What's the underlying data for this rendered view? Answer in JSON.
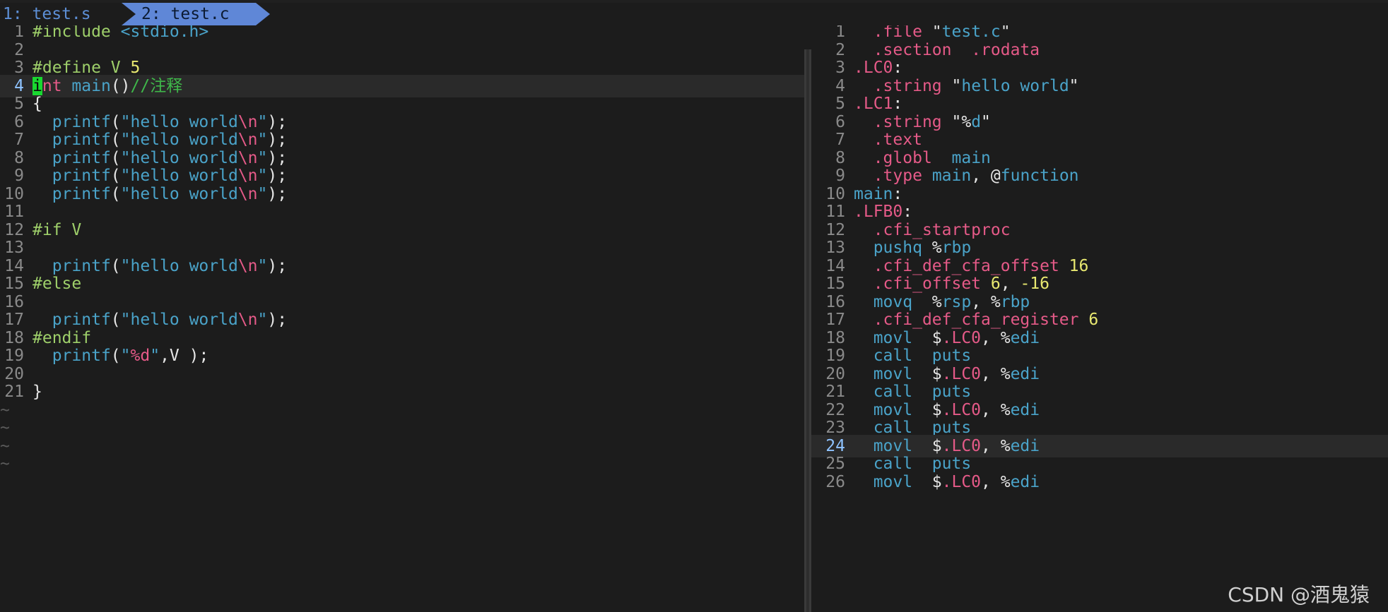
{
  "tabs": [
    {
      "label": "1: test.s",
      "active": false
    },
    {
      "label": "2: test.c",
      "active": true
    }
  ],
  "left_pane": {
    "cursor_line": 4,
    "lines": [
      {
        "n": "1",
        "tokens": [
          [
            "c-pre",
            "#include "
          ],
          [
            "c-str",
            "<stdio.h>"
          ]
        ]
      },
      {
        "n": "2",
        "tokens": []
      },
      {
        "n": "3",
        "tokens": [
          [
            "c-pre",
            "#define V "
          ],
          [
            "c-num",
            "5"
          ]
        ]
      },
      {
        "n": "4",
        "tokens": [
          [
            "cursor",
            "i"
          ],
          [
            "c-kw",
            "nt"
          ],
          [
            "c-txt",
            " "
          ],
          [
            "c-fn",
            "main"
          ],
          [
            "c-txt",
            "()"
          ],
          [
            "c-cmt",
            "//注释"
          ]
        ]
      },
      {
        "n": "5",
        "tokens": [
          [
            "c-txt",
            "{"
          ]
        ]
      },
      {
        "n": "6",
        "tokens": [
          [
            "c-txt",
            "  "
          ],
          [
            "c-fn",
            "printf"
          ],
          [
            "c-txt",
            "("
          ],
          [
            "c-str",
            "\"hello world"
          ],
          [
            "c-esc",
            "\\n"
          ],
          [
            "c-str",
            "\""
          ],
          [
            "c-txt",
            ");"
          ]
        ]
      },
      {
        "n": "7",
        "tokens": [
          [
            "c-txt",
            "  "
          ],
          [
            "c-fn",
            "printf"
          ],
          [
            "c-txt",
            "("
          ],
          [
            "c-str",
            "\"hello world"
          ],
          [
            "c-esc",
            "\\n"
          ],
          [
            "c-str",
            "\""
          ],
          [
            "c-txt",
            ");"
          ]
        ]
      },
      {
        "n": "8",
        "tokens": [
          [
            "c-txt",
            "  "
          ],
          [
            "c-fn",
            "printf"
          ],
          [
            "c-txt",
            "("
          ],
          [
            "c-str",
            "\"hello world"
          ],
          [
            "c-esc",
            "\\n"
          ],
          [
            "c-str",
            "\""
          ],
          [
            "c-txt",
            ");"
          ]
        ]
      },
      {
        "n": "9",
        "tokens": [
          [
            "c-txt",
            "  "
          ],
          [
            "c-fn",
            "printf"
          ],
          [
            "c-txt",
            "("
          ],
          [
            "c-str",
            "\"hello world"
          ],
          [
            "c-esc",
            "\\n"
          ],
          [
            "c-str",
            "\""
          ],
          [
            "c-txt",
            ");"
          ]
        ]
      },
      {
        "n": "10",
        "tokens": [
          [
            "c-txt",
            "  "
          ],
          [
            "c-fn",
            "printf"
          ],
          [
            "c-txt",
            "("
          ],
          [
            "c-str",
            "\"hello world"
          ],
          [
            "c-esc",
            "\\n"
          ],
          [
            "c-str",
            "\""
          ],
          [
            "c-txt",
            ");"
          ]
        ]
      },
      {
        "n": "11",
        "tokens": []
      },
      {
        "n": "12",
        "tokens": [
          [
            "c-pre",
            "#if V"
          ]
        ]
      },
      {
        "n": "13",
        "tokens": []
      },
      {
        "n": "14",
        "tokens": [
          [
            "c-txt",
            "  "
          ],
          [
            "c-fn",
            "printf"
          ],
          [
            "c-txt",
            "("
          ],
          [
            "c-str",
            "\"hello world"
          ],
          [
            "c-esc",
            "\\n"
          ],
          [
            "c-str",
            "\""
          ],
          [
            "c-txt",
            ");"
          ]
        ]
      },
      {
        "n": "15",
        "tokens": [
          [
            "c-pre",
            "#else"
          ]
        ]
      },
      {
        "n": "16",
        "tokens": []
      },
      {
        "n": "17",
        "tokens": [
          [
            "c-txt",
            "  "
          ],
          [
            "c-fn",
            "printf"
          ],
          [
            "c-txt",
            "("
          ],
          [
            "c-str",
            "\"hello world"
          ],
          [
            "c-esc",
            "\\n"
          ],
          [
            "c-str",
            "\""
          ],
          [
            "c-txt",
            ");"
          ]
        ]
      },
      {
        "n": "18",
        "tokens": [
          [
            "c-pre",
            "#endif"
          ]
        ]
      },
      {
        "n": "19",
        "tokens": [
          [
            "c-txt",
            "  "
          ],
          [
            "c-fn",
            "printf"
          ],
          [
            "c-txt",
            "("
          ],
          [
            "c-str",
            "\""
          ],
          [
            "c-esc",
            "%d"
          ],
          [
            "c-str",
            "\""
          ],
          [
            "c-txt",
            ",V );"
          ]
        ]
      },
      {
        "n": "20",
        "tokens": []
      },
      {
        "n": "21",
        "tokens": [
          [
            "c-txt",
            "}"
          ]
        ]
      }
    ],
    "tilde_rows": 4,
    "tilde_char": "~"
  },
  "right_pane": {
    "cursor_line": 24,
    "lines": [
      {
        "n": "1",
        "tokens": [
          [
            "a-txt",
            "  "
          ],
          [
            "a-dir",
            ".file"
          ],
          [
            "a-txt",
            " \""
          ],
          [
            "a-str",
            "test.c"
          ],
          [
            "a-txt",
            "\""
          ]
        ]
      },
      {
        "n": "2",
        "tokens": [
          [
            "a-txt",
            "  "
          ],
          [
            "a-dir",
            ".section"
          ],
          [
            "a-txt",
            "  "
          ],
          [
            "a-dir",
            ".rodata"
          ]
        ]
      },
      {
        "n": "3",
        "tokens": [
          [
            "a-dir",
            ".LC0"
          ],
          [
            "a-txt",
            ":"
          ]
        ]
      },
      {
        "n": "4",
        "tokens": [
          [
            "a-txt",
            "  "
          ],
          [
            "a-dir",
            ".string"
          ],
          [
            "a-txt",
            " \""
          ],
          [
            "a-str",
            "hello world"
          ],
          [
            "a-txt",
            "\""
          ]
        ]
      },
      {
        "n": "5",
        "tokens": [
          [
            "a-dir",
            ".LC1"
          ],
          [
            "a-txt",
            ":"
          ]
        ]
      },
      {
        "n": "6",
        "tokens": [
          [
            "a-txt",
            "  "
          ],
          [
            "a-dir",
            ".string"
          ],
          [
            "a-txt",
            " \"%"
          ],
          [
            "a-str",
            "d"
          ],
          [
            "a-txt",
            "\""
          ]
        ]
      },
      {
        "n": "7",
        "tokens": [
          [
            "a-txt",
            "  "
          ],
          [
            "a-dir",
            ".text"
          ]
        ]
      },
      {
        "n": "8",
        "tokens": [
          [
            "a-txt",
            "  "
          ],
          [
            "a-dir",
            ".globl"
          ],
          [
            "a-txt",
            "  "
          ],
          [
            "a-ins",
            "main"
          ]
        ]
      },
      {
        "n": "9",
        "tokens": [
          [
            "a-txt",
            "  "
          ],
          [
            "a-dir",
            ".type"
          ],
          [
            "a-txt",
            " "
          ],
          [
            "a-ins",
            "main"
          ],
          [
            "a-txt",
            ", @"
          ],
          [
            "a-ins",
            "function"
          ]
        ]
      },
      {
        "n": "10",
        "tokens": [
          [
            "a-ins",
            "main"
          ],
          [
            "a-txt",
            ":"
          ]
        ]
      },
      {
        "n": "11",
        "tokens": [
          [
            "a-dir",
            ".LFB0"
          ],
          [
            "a-txt",
            ":"
          ]
        ]
      },
      {
        "n": "12",
        "tokens": [
          [
            "a-txt",
            "  "
          ],
          [
            "a-dir",
            ".cfi_startproc"
          ]
        ]
      },
      {
        "n": "13",
        "tokens": [
          [
            "a-txt",
            "  "
          ],
          [
            "a-ins",
            "pushq"
          ],
          [
            "a-txt",
            " %"
          ],
          [
            "a-reg",
            "rbp"
          ]
        ]
      },
      {
        "n": "14",
        "tokens": [
          [
            "a-txt",
            "  "
          ],
          [
            "a-dir",
            ".cfi_def_cfa_offset"
          ],
          [
            "a-txt",
            " "
          ],
          [
            "a-num",
            "16"
          ]
        ]
      },
      {
        "n": "15",
        "tokens": [
          [
            "a-txt",
            "  "
          ],
          [
            "a-dir",
            ".cfi_offset"
          ],
          [
            "a-txt",
            " "
          ],
          [
            "a-num",
            "6"
          ],
          [
            "a-txt",
            ", "
          ],
          [
            "a-num",
            "-16"
          ]
        ]
      },
      {
        "n": "16",
        "tokens": [
          [
            "a-txt",
            "  "
          ],
          [
            "a-ins",
            "movq"
          ],
          [
            "a-txt",
            "  %"
          ],
          [
            "a-reg",
            "rsp"
          ],
          [
            "a-txt",
            ", %"
          ],
          [
            "a-reg",
            "rbp"
          ]
        ]
      },
      {
        "n": "17",
        "tokens": [
          [
            "a-txt",
            "  "
          ],
          [
            "a-dir",
            ".cfi_def_cfa_register"
          ],
          [
            "a-txt",
            " "
          ],
          [
            "a-num",
            "6"
          ]
        ]
      },
      {
        "n": "18",
        "tokens": [
          [
            "a-txt",
            "  "
          ],
          [
            "a-ins",
            "movl"
          ],
          [
            "a-txt",
            "  $"
          ],
          [
            "a-dir",
            ".LC0"
          ],
          [
            "a-txt",
            ", %"
          ],
          [
            "a-reg",
            "edi"
          ]
        ]
      },
      {
        "n": "19",
        "tokens": [
          [
            "a-txt",
            "  "
          ],
          [
            "a-ins",
            "call"
          ],
          [
            "a-txt",
            "  "
          ],
          [
            "a-ins",
            "puts"
          ]
        ]
      },
      {
        "n": "20",
        "tokens": [
          [
            "a-txt",
            "  "
          ],
          [
            "a-ins",
            "movl"
          ],
          [
            "a-txt",
            "  $"
          ],
          [
            "a-dir",
            ".LC0"
          ],
          [
            "a-txt",
            ", %"
          ],
          [
            "a-reg",
            "edi"
          ]
        ]
      },
      {
        "n": "21",
        "tokens": [
          [
            "a-txt",
            "  "
          ],
          [
            "a-ins",
            "call"
          ],
          [
            "a-txt",
            "  "
          ],
          [
            "a-ins",
            "puts"
          ]
        ]
      },
      {
        "n": "22",
        "tokens": [
          [
            "a-txt",
            "  "
          ],
          [
            "a-ins",
            "movl"
          ],
          [
            "a-txt",
            "  $"
          ],
          [
            "a-dir",
            ".LC0"
          ],
          [
            "a-txt",
            ", %"
          ],
          [
            "a-reg",
            "edi"
          ]
        ]
      },
      {
        "n": "23",
        "tokens": [
          [
            "a-txt",
            "  "
          ],
          [
            "a-ins",
            "call"
          ],
          [
            "a-txt",
            "  "
          ],
          [
            "a-ins",
            "puts"
          ]
        ]
      },
      {
        "n": "24",
        "tokens": [
          [
            "a-txt",
            "  "
          ],
          [
            "a-ins",
            "movl"
          ],
          [
            "a-txt",
            "  $"
          ],
          [
            "a-dir",
            ".LC0"
          ],
          [
            "a-txt",
            ", %"
          ],
          [
            "a-reg",
            "edi"
          ]
        ]
      },
      {
        "n": "25",
        "tokens": [
          [
            "a-txt",
            "  "
          ],
          [
            "a-ins",
            "call"
          ],
          [
            "a-txt",
            "  "
          ],
          [
            "a-ins",
            "puts"
          ]
        ]
      },
      {
        "n": "26",
        "tokens": [
          [
            "a-txt",
            "  "
          ],
          [
            "a-ins",
            "movl"
          ],
          [
            "a-txt",
            "  $"
          ],
          [
            "a-dir",
            ".LC0"
          ],
          [
            "a-txt",
            ", %"
          ],
          [
            "a-reg",
            "edi"
          ]
        ]
      }
    ]
  },
  "watermark": "CSDN @酒鬼猿",
  "colors": {
    "background": "#1c1c1c",
    "active_tab": "#5f87d7",
    "cursor": "#19d830",
    "preprocessor": "#9ecf6a",
    "string": "#4aa3c9",
    "keyword": "#e55a88",
    "number": "#e8e870",
    "comment": "#3fb84a"
  }
}
